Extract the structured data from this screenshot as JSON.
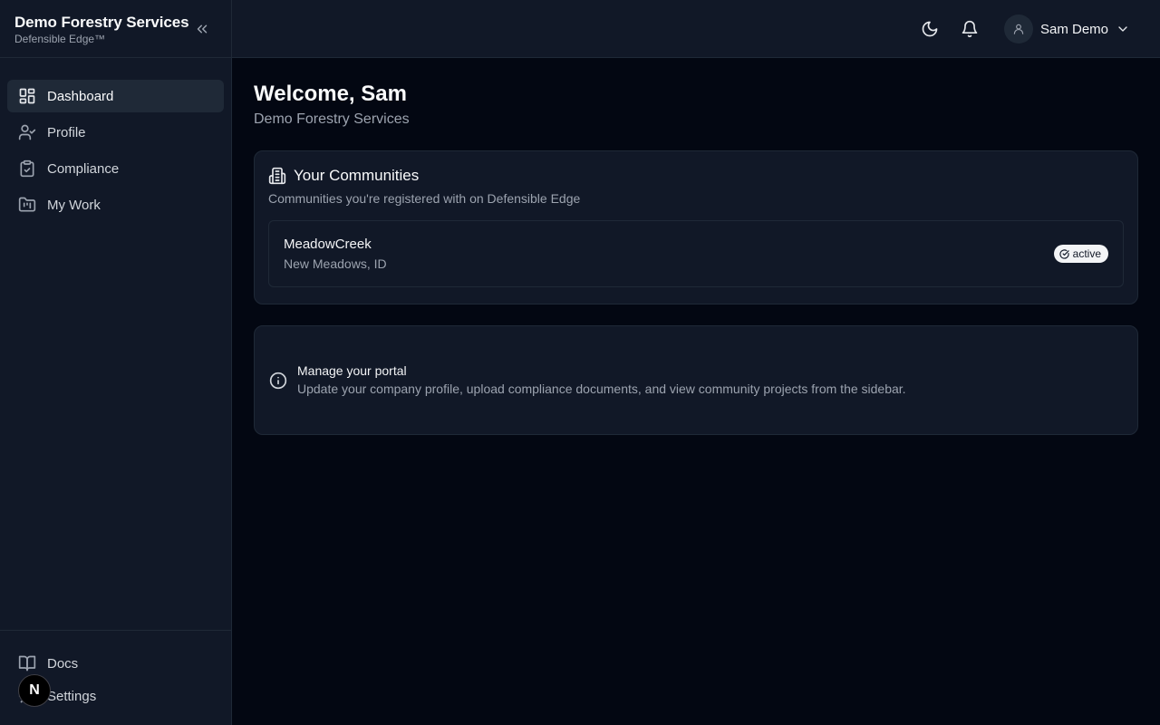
{
  "sidebar": {
    "brand_title": "Demo Forestry Services",
    "brand_sub": "Defensible Edge™",
    "items": [
      {
        "label": "Dashboard",
        "icon": "dashboard-icon",
        "active": true
      },
      {
        "label": "Profile",
        "icon": "user-check-icon"
      },
      {
        "label": "Compliance",
        "icon": "clipboard-check-icon"
      },
      {
        "label": "My Work",
        "icon": "folder-kanban-icon"
      }
    ],
    "footer": [
      {
        "label": "Docs",
        "icon": "book-open-icon"
      },
      {
        "label": "Settings",
        "icon": "gear-icon"
      }
    ],
    "badge_letter": "N"
  },
  "topbar": {
    "user_name": "Sam Demo"
  },
  "main": {
    "title": "Welcome, Sam",
    "subtitle": "Demo Forestry Services",
    "communities": {
      "title": "Your Communities",
      "description": "Communities you're registered with on Defensible Edge",
      "items": [
        {
          "name": "MeadowCreek",
          "location": "New Meadows, ID",
          "status": "active"
        }
      ]
    },
    "info": {
      "title": "Manage your portal",
      "text": "Update your company profile, upload compliance documents, and view community projects from the sidebar."
    }
  },
  "colors": {
    "background": "#030712",
    "panel": "#111827",
    "border": "#1f2937",
    "active_item": "#1f2937",
    "badge_bg": "#f3f4f6"
  }
}
